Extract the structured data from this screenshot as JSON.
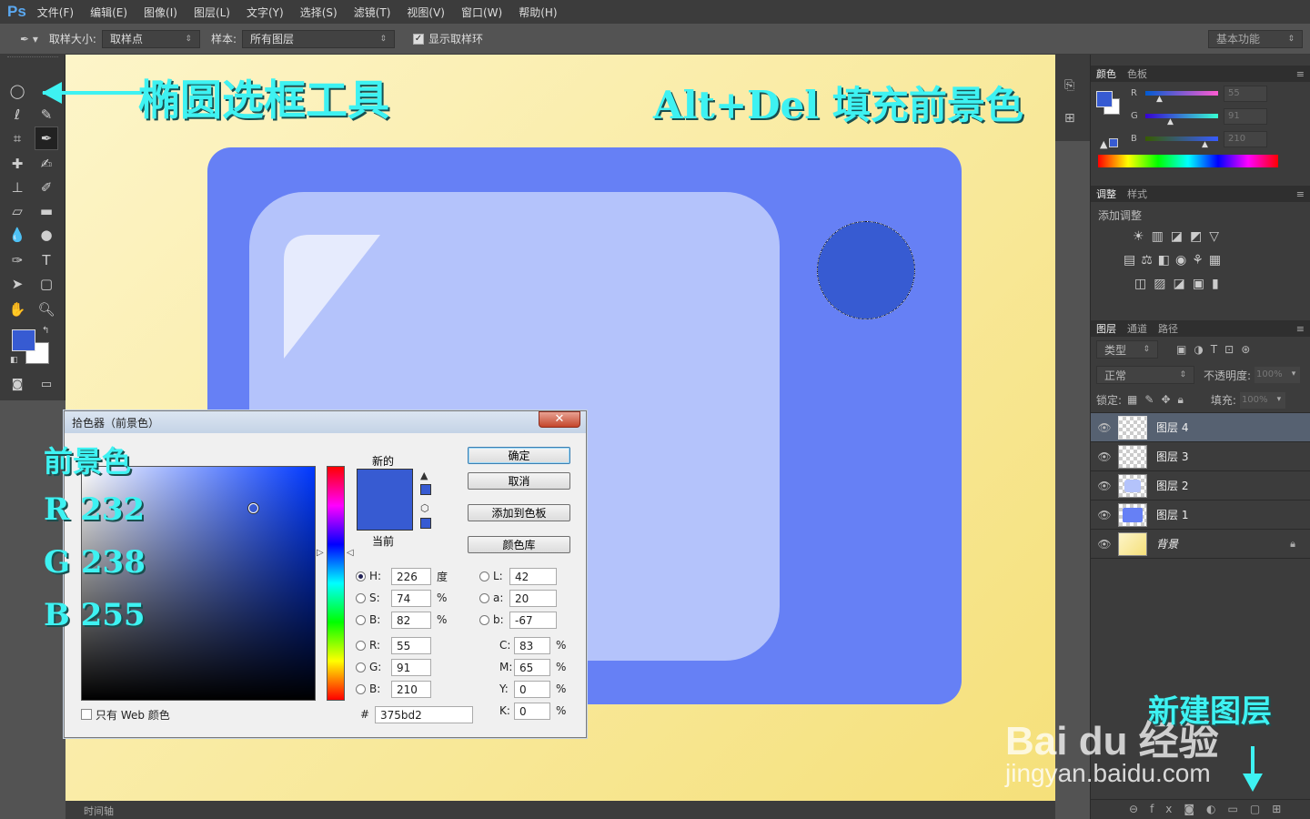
{
  "app": {
    "logo": "Ps"
  },
  "menu": [
    "文件(F)",
    "编辑(E)",
    "图像(I)",
    "图层(L)",
    "文字(Y)",
    "选择(S)",
    "滤镜(T)",
    "视图(V)",
    "窗口(W)",
    "帮助(H)"
  ],
  "options": {
    "sample_size_label": "取样大小:",
    "sample_size_value": "取样点",
    "sample_label": "样本:",
    "sample_value": "所有图层",
    "show_ring_label": "显示取样环",
    "workspace": "基本功能"
  },
  "annotations": {
    "ellipse_tool": "椭圆选框工具",
    "fill_hint": "Alt+Del 填充前景色",
    "fg_title": "前景色",
    "fg_r": "R 232",
    "fg_g": "G 238",
    "fg_b": "B 255",
    "new_layer": "新建图层"
  },
  "watermark": {
    "brand": "Bai du 经验",
    "url": "jingyan.baidu.com"
  },
  "color_panel": {
    "tabs": [
      "颜色",
      "色板"
    ],
    "r": "55",
    "g": "91",
    "b": "210",
    "r_label": "R",
    "g_label": "G",
    "b_label": "B"
  },
  "adjust_panel": {
    "tabs": [
      "调整",
      "样式"
    ],
    "title": "添加调整"
  },
  "layers_panel": {
    "tabs": [
      "图层",
      "通道",
      "路径"
    ],
    "filter": "类型",
    "blend": "正常",
    "opacity_label": "不透明度:",
    "opacity": "100%",
    "lock_label": "锁定:",
    "fill_label": "填充:",
    "fill": "100%",
    "layers": [
      {
        "name": "图层 4"
      },
      {
        "name": "图层 3"
      },
      {
        "name": "图层 2"
      },
      {
        "name": "图层 1"
      },
      {
        "name": "背景"
      }
    ]
  },
  "timeline": {
    "label": "时间轴"
  },
  "color_picker": {
    "title": "拾色器（前景色）",
    "new_label": "新的",
    "current_label": "当前",
    "ok": "确定",
    "cancel": "取消",
    "add_swatch": "添加到色板",
    "library": "颜色库",
    "web_only": "只有 Web 颜色",
    "h": "226",
    "s": "74",
    "bv": "82",
    "r": "55",
    "g": "91",
    "b": "210",
    "l": "42",
    "a": "20",
    "lab_b": "-67",
    "c": "83",
    "m": "65",
    "y": "0",
    "k": "0",
    "hex": "375bd2",
    "unit_deg": "度",
    "unit_pct": "%",
    "lbl_h": "H:",
    "lbl_s": "S:",
    "lbl_b": "B:",
    "lbl_r": "R:",
    "lbl_g": "G:",
    "lbl_bb": "B:",
    "lbl_l": "L:",
    "lbl_a": "a:",
    "lbl_lb": "b:",
    "lbl_c": "C:",
    "lbl_m": "M:",
    "lbl_y": "Y:",
    "lbl_k": "K:",
    "lbl_hex": "#"
  },
  "colors": {
    "foreground": "#375bd2",
    "card_outer": "#6680f5",
    "card_inner": "#b4c3fb"
  }
}
